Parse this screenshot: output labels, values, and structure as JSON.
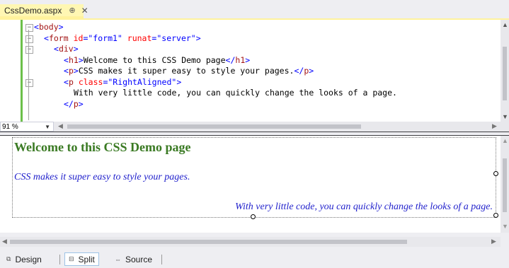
{
  "document_tab": {
    "title": "CssDemo.aspx",
    "pin_icon": "pin-icon",
    "close_icon": "close-icon"
  },
  "source_code": {
    "lines": [
      {
        "indent": 0,
        "fold": "minus",
        "html": "<span class='br'>&lt;</span><span class='tag'>body</span><span class='br'>&gt;</span>"
      },
      {
        "indent": 1,
        "fold": "minus",
        "html": "<span class='br'>&lt;</span><span class='tag'>form</span> <span class='attr'>id</span><span class='br'>=</span><span class='val'>\"form1\"</span> <span class='attr'>runat</span><span class='br'>=</span><span class='val'>\"server\"</span><span class='br'>&gt;</span>"
      },
      {
        "indent": 2,
        "fold": "minus",
        "html": "<span class='br'>&lt;</span><span class='tag'>div</span><span class='br'>&gt;</span>"
      },
      {
        "indent": 3,
        "fold": "",
        "html": "<span class='br'>&lt;</span><span class='tag'>h1</span><span class='br'>&gt;</span><span class='txt'>Welcome to this CSS Demo page</span><span class='br'>&lt;/</span><span class='tag'>h1</span><span class='br'>&gt;</span>"
      },
      {
        "indent": 3,
        "fold": "",
        "html": "<span class='br'>&lt;</span><span class='tag'>p</span><span class='br'>&gt;</span><span class='txt'>CSS makes it super easy to style your pages.</span><span class='br'>&lt;/</span><span class='tag'>p</span><span class='br'>&gt;</span>"
      },
      {
        "indent": 3,
        "fold": "minus",
        "html": "<span class='br'>&lt;</span><span class='tag'>p</span> <span class='attr'>class</span><span class='br'>=</span><span class='val'>\"RightAligned\"</span><span class='br'>&gt;</span>"
      },
      {
        "indent": 4,
        "fold": "",
        "html": "<span class='txt'>With very little code, you can quickly change the looks of a page.</span>"
      },
      {
        "indent": 3,
        "fold": "",
        "html": "<span class='br'>&lt;/</span><span class='tag'>p</span><span class='br'>&gt;</span>"
      }
    ]
  },
  "zoom": {
    "value": "91 %"
  },
  "design_view": {
    "heading": "Welcome to this CSS Demo page",
    "paragraph1": "CSS makes it super easy to style your pages.",
    "paragraph2": "With very little code, you can quickly change the looks of a page.",
    "heading_color": "#3a7a23",
    "text_color": "#2222cc"
  },
  "view_tabs": [
    {
      "label": "Design",
      "icon": "design-view-icon",
      "active": false
    },
    {
      "label": "Split",
      "icon": "split-view-icon",
      "active": true
    },
    {
      "label": "Source",
      "icon": "source-view-icon",
      "active": false
    }
  ]
}
